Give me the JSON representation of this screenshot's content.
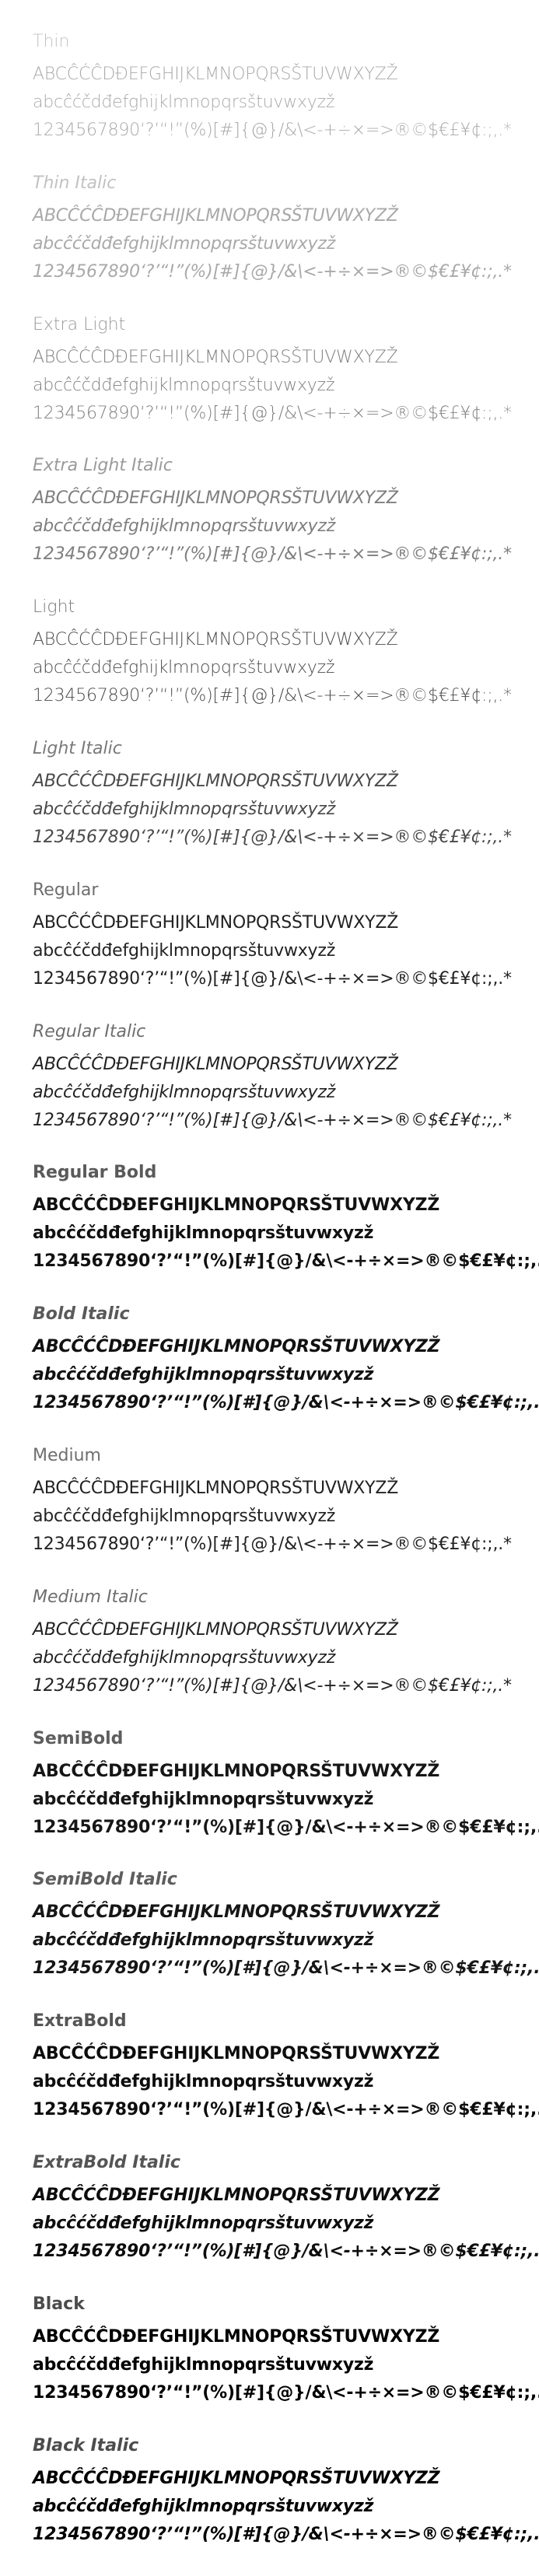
{
  "lines": {
    "upper": "ABCĈĆĈDĐEFGHIJKLMNOPQRSŠTUVWXYZŽ",
    "lower": "abcĉćčdđefghijklmnopqrsštuvwxyzž",
    "digits": "1234567890‘?’“!”(%)[#]{@}/&\\<-+÷×=>®©$€£¥¢:;,.*"
  },
  "weights": [
    {
      "name": "Thin",
      "weight": 100,
      "italic": false,
      "name_color": "#c2c2c2",
      "text_color": "#a9a9a9"
    },
    {
      "name": "Thin Italic",
      "weight": 100,
      "italic": true,
      "name_color": "#c2c2c2",
      "text_color": "#a9a9a9"
    },
    {
      "name": "Extra Light",
      "weight": 200,
      "italic": false,
      "name_color": "#9a9a9a",
      "text_color": "#7f7f7f"
    },
    {
      "name": "Extra Light Italic",
      "weight": 200,
      "italic": true,
      "name_color": "#9a9a9a",
      "text_color": "#7f7f7f"
    },
    {
      "name": "Light",
      "weight": 300,
      "italic": false,
      "name_color": "#7a7a7a",
      "text_color": "#4a4a4a"
    },
    {
      "name": "Light Italic",
      "weight": 300,
      "italic": true,
      "name_color": "#7a7a7a",
      "text_color": "#4a4a4a"
    },
    {
      "name": "Regular",
      "weight": 400,
      "italic": false,
      "name_color": "#6e6e6e",
      "text_color": "#222222"
    },
    {
      "name": "Regular Italic",
      "weight": 400,
      "italic": true,
      "name_color": "#6e6e6e",
      "text_color": "#222222"
    },
    {
      "name": "Regular Bold",
      "weight": 700,
      "italic": false,
      "name_color": "#5a5a5a",
      "text_color": "#111111"
    },
    {
      "name": "Bold Italic",
      "weight": 700,
      "italic": true,
      "name_color": "#5a5a5a",
      "text_color": "#111111"
    },
    {
      "name": "Medium",
      "weight": 500,
      "italic": false,
      "name_color": "#6e6e6e",
      "text_color": "#222222"
    },
    {
      "name": "Medium Italic",
      "weight": 500,
      "italic": true,
      "name_color": "#6e6e6e",
      "text_color": "#222222"
    },
    {
      "name": "SemiBold",
      "weight": 600,
      "italic": false,
      "name_color": "#5e5e5e",
      "text_color": "#161616"
    },
    {
      "name": "SemiBold Italic",
      "weight": 600,
      "italic": true,
      "name_color": "#5e5e5e",
      "text_color": "#161616"
    },
    {
      "name": "ExtraBold",
      "weight": 800,
      "italic": false,
      "name_color": "#555555",
      "text_color": "#0d0d0d"
    },
    {
      "name": "ExtraBold Italic",
      "weight": 800,
      "italic": true,
      "name_color": "#555555",
      "text_color": "#0d0d0d"
    },
    {
      "name": "Black",
      "weight": 900,
      "italic": false,
      "name_color": "#4c4c4c",
      "text_color": "#000000"
    },
    {
      "name": "Black Italic",
      "weight": 900,
      "italic": true,
      "name_color": "#4c4c4c",
      "text_color": "#000000"
    }
  ]
}
